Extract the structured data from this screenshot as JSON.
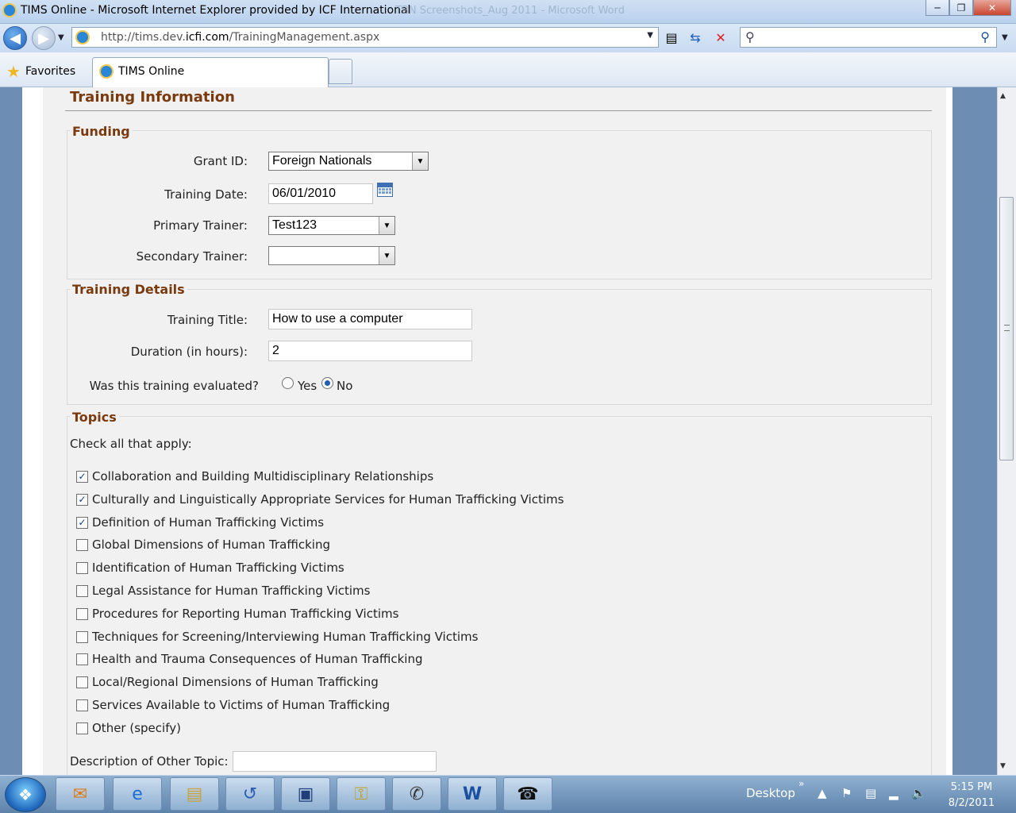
{
  "window": {
    "title": "TIMS Online - Microsoft Internet Explorer provided by ICF International",
    "background_window_title": "TBN Screenshots_Aug 2011 - Microsoft Word",
    "minimize": "─",
    "maximize": "❐",
    "close": "✕"
  },
  "navigation": {
    "url_prefix": "http://tims.dev.",
    "url_domain": "icfi.com",
    "url_path": "/TrainingManagement.aspx",
    "search_placeholder": ""
  },
  "favorites_bar": {
    "favorites_label": "Favorites",
    "tab_label": "TIMS Online"
  },
  "page": {
    "section_title": "Training Information",
    "funding": {
      "legend": "Funding",
      "grant_id_label": "Grant ID:",
      "grant_id_value": "Foreign Nationals",
      "training_date_label": "Training Date:",
      "training_date_value": "06/01/2010",
      "primary_trainer_label": "Primary Trainer:",
      "primary_trainer_value": "Test123",
      "secondary_trainer_label": "Secondary Trainer:",
      "secondary_trainer_value": ""
    },
    "details": {
      "legend": "Training Details",
      "title_label": "Training Title:",
      "title_value": "How to use a computer",
      "duration_label": "Duration (in hours):",
      "duration_value": "2",
      "evaluated_label": "Was this training evaluated?",
      "yes_label": "Yes",
      "no_label": "No",
      "evaluated_selected": "No"
    },
    "topics": {
      "legend": "Topics",
      "instruction": "Check all that apply:",
      "items": [
        {
          "label": "Collaboration and Building Multidisciplinary Relationships",
          "checked": true
        },
        {
          "label": "Culturally and Linguistically Appropriate Services for Human Trafficking Victims",
          "checked": true
        },
        {
          "label": "Definition of Human Trafficking Victims",
          "checked": true
        },
        {
          "label": "Global Dimensions of Human Trafficking",
          "checked": false
        },
        {
          "label": "Identification of Human Trafficking Victims",
          "checked": false
        },
        {
          "label": "Legal Assistance for Human Trafficking Victims",
          "checked": false
        },
        {
          "label": "Procedures for Reporting Human Trafficking Victims",
          "checked": false
        },
        {
          "label": "Techniques for Screening/Interviewing Human Trafficking Victims",
          "checked": false
        },
        {
          "label": "Health and Trauma Consequences of Human Trafficking",
          "checked": false
        },
        {
          "label": "Local/Regional Dimensions of Human Trafficking",
          "checked": false
        },
        {
          "label": "Services Available to Victims of Human Trafficking",
          "checked": false
        },
        {
          "label": "Other (specify)",
          "checked": false
        }
      ],
      "other_desc_label": "Description of Other Topic:",
      "other_desc_value": ""
    }
  },
  "taskbar": {
    "desktop_label": "Desktop",
    "time": "5:15 PM",
    "date": "8/2/2011"
  },
  "colors": {
    "section_heading": "#7a3a0e",
    "panel_background": "#f1f1f1",
    "page_frame": "#6d8db3"
  }
}
